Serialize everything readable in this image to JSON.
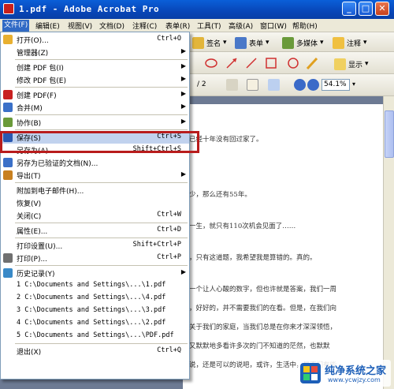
{
  "window": {
    "title": "1.pdf - Adobe Acrobat Pro",
    "minimize": "_",
    "maximize": "□",
    "close": "✕"
  },
  "menubar": [
    {
      "label": "文件(F)",
      "active": true
    },
    {
      "label": "编辑(E)"
    },
    {
      "label": "视图(V)"
    },
    {
      "label": "文档(D)"
    },
    {
      "label": "注释(C)"
    },
    {
      "label": "表单(R)"
    },
    {
      "label": "工具(T)"
    },
    {
      "label": "高级(A)"
    },
    {
      "label": "窗口(W)"
    },
    {
      "label": "帮助(H)"
    }
  ],
  "toolbar": {
    "sign": "签名",
    "form": "表单",
    "multimedia": "多媒体",
    "comment": "注释",
    "show": "显示",
    "page_total": "/ 2",
    "zoom": "54.1%"
  },
  "file_menu": {
    "items": [
      {
        "label": "打开(O)...",
        "shortcut": "Ctrl+O",
        "icon": "open-folder-icon"
      },
      {
        "label": "管理器(Z)",
        "submenu": true
      },
      {
        "sep": true
      },
      {
        "label": "创建 PDF 包(I)",
        "submenu": true
      },
      {
        "label": "修改 PDF 包(E)",
        "submenu": true
      },
      {
        "sep": true
      },
      {
        "label": "创建 PDF(F)",
        "submenu": true,
        "icon": "create-pdf-icon"
      },
      {
        "label": "合并(M)",
        "submenu": true,
        "icon": "combine-icon"
      },
      {
        "sep": true
      },
      {
        "label": "协作(B)",
        "submenu": true,
        "icon": "collaborate-icon"
      },
      {
        "sep": true
      },
      {
        "label": "保存(S)",
        "shortcut": "Ctrl+S",
        "icon": "save-icon",
        "highlighted": true
      },
      {
        "label": "另存为(A)...",
        "shortcut": "Shift+Ctrl+S"
      },
      {
        "label": "另存为已验证的文档(N)...",
        "icon": "certified-icon"
      },
      {
        "label": "导出(T)",
        "submenu": true,
        "icon": "export-icon"
      },
      {
        "sep": true
      },
      {
        "label": "附加到电子邮件(H)..."
      },
      {
        "label": "恢复(V)"
      },
      {
        "label": "关闭(C)",
        "shortcut": "Ctrl+W"
      },
      {
        "sep": true
      },
      {
        "label": "属性(E)...",
        "shortcut": "Ctrl+D"
      },
      {
        "sep": true
      },
      {
        "label": "打印设置(U)...",
        "shortcut": "Shift+Ctrl+P"
      },
      {
        "label": "打印(P)...",
        "shortcut": "Ctrl+P",
        "icon": "printer-icon"
      },
      {
        "sep": true
      },
      {
        "label": "历史记录(Y)",
        "submenu": true,
        "icon": "history-icon"
      },
      {
        "label": "1 C:\\Documents and Settings\\...\\1.pdf",
        "mono": true
      },
      {
        "label": "2 C:\\Documents and Settings\\...\\4.pdf",
        "mono": true
      },
      {
        "label": "3 C:\\Documents and Settings\\...\\3.pdf",
        "mono": true
      },
      {
        "label": "4 C:\\Documents and Settings\\...\\2.pdf",
        "mono": true
      },
      {
        "label": "5 C:\\Documents and Settings\\...\\PDF.pdf",
        "mono": true
      },
      {
        "sep": true
      },
      {
        "label": "退出(X)",
        "shortcut": "Ctrl+Q"
      }
    ]
  },
  "document_lines": [
    "已经十年没有回过家了。",
    "少，那么还有55年。",
    "一生，就只有110次机会见面了……",
    "，只有这道题，我希望我是算错的。真的。",
    "一个让人心酸的数字，但也许就是答案，我们一周",
    "，好好的，并不需要我们的在看。但是，在我们向",
    "关于我们的家庭，当我们总是在你来才深深领悟，",
    "又默默地多看许多次的门不知道的茫然，也默默",
    "说，还是可以的说吧，或许，生活中，是否们有些"
  ],
  "watermark": {
    "title": "纯净系统之家",
    "url": "www.ycwjzy.com"
  },
  "colors": {
    "titlebar": "#0846b8",
    "menu_highlight": "#c1d2ee",
    "annotation_box": "#b81c1c"
  }
}
